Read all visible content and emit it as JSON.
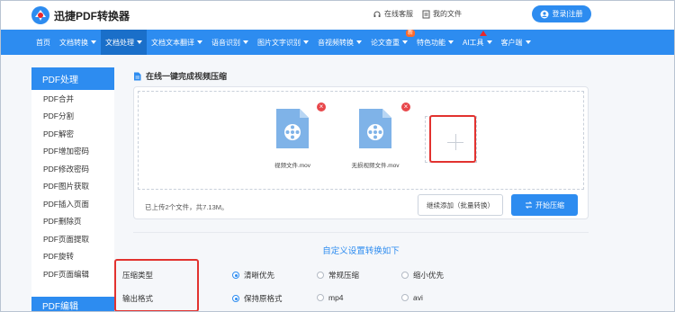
{
  "header": {
    "app_name": "迅捷PDF转换器",
    "service_label": "在线客服",
    "files_label": "我的文件",
    "login_label": "登录|注册"
  },
  "nav": {
    "items": [
      {
        "label": "首页",
        "dropdown": false
      },
      {
        "label": "文档转换",
        "dropdown": true
      },
      {
        "label": "文档处理",
        "dropdown": true,
        "active": true
      },
      {
        "label": "文档文本翻译",
        "dropdown": true
      },
      {
        "label": "语音识别",
        "dropdown": true
      },
      {
        "label": "图片文字识别",
        "dropdown": true
      },
      {
        "label": "音视频转换",
        "dropdown": true
      },
      {
        "label": "论文查重",
        "dropdown": true,
        "badge": "新"
      },
      {
        "label": "特色功能",
        "dropdown": true
      },
      {
        "label": "AI工具",
        "dropdown": true
      },
      {
        "label": "客户端",
        "dropdown": true
      }
    ]
  },
  "sidebar": {
    "section1_title": "PDF处理",
    "items": [
      "PDF合并",
      "PDF分割",
      "PDF解密",
      "PDF增加密码",
      "PDF修改密码",
      "PDF图片获取",
      "PDF插入页面",
      "PDF删除页",
      "PDF页面提取",
      "PDF旋转",
      "PDF页面编辑"
    ],
    "section2_title": "PDF编辑"
  },
  "main": {
    "title": "在线一键完成视频压缩",
    "files": [
      {
        "name": "视频文件.mov"
      },
      {
        "name": "无损视频文件.mov"
      }
    ],
    "upload_info": "已上传2个文件，共7.13M。",
    "add_more_label": "继续添加（批量转换）",
    "start_label": "开始压缩"
  },
  "settings": {
    "title": "自定义设置转换如下",
    "compress_type_label": "压缩类型",
    "compress_options": [
      {
        "label": "清晰优先",
        "selected": true
      },
      {
        "label": "常规压缩",
        "selected": false
      },
      {
        "label": "缩小优先",
        "selected": false
      }
    ],
    "output_format_label": "输出格式",
    "format_options": [
      {
        "label": "保持原格式",
        "selected": true
      },
      {
        "label": "mp4",
        "selected": false
      },
      {
        "label": "avi",
        "selected": false
      }
    ]
  },
  "colors": {
    "primary": "#2d8cf0",
    "highlight": "#e2322f",
    "file_icon": "#7fb3e8"
  }
}
